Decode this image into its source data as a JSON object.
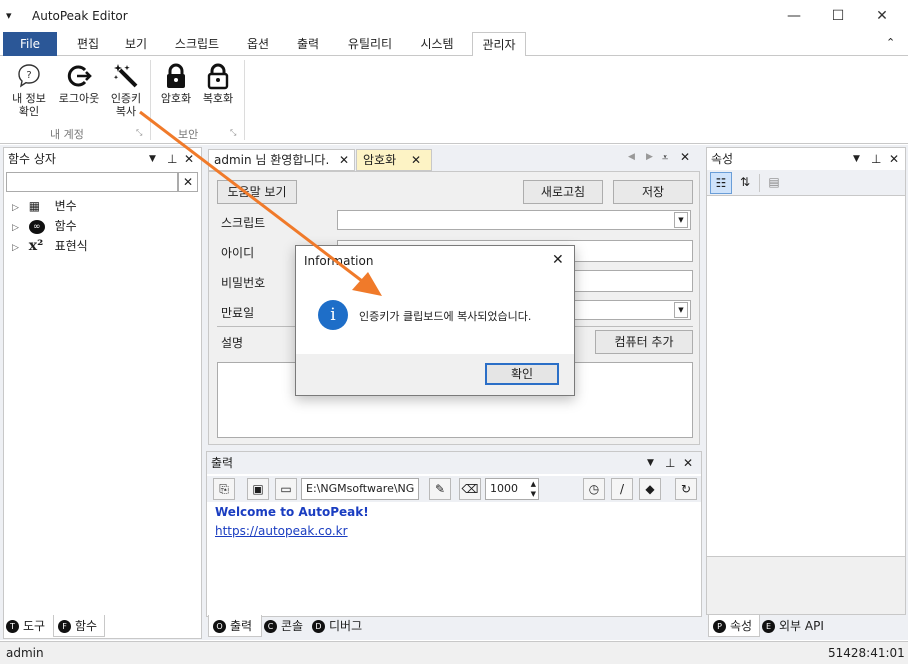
{
  "window": {
    "title": "AutoPeak Editor",
    "sys_menu_glyph": "▾",
    "min_glyph": "—",
    "max_glyph": "☐",
    "close_glyph": "✕"
  },
  "menu": {
    "file": "File",
    "tabs": [
      "편집",
      "보기",
      "스크립트",
      "옵션",
      "출력",
      "유틸리티",
      "시스템",
      "관리자"
    ],
    "collapse_glyph": "⌃"
  },
  "ribbon": {
    "account_buttons": [
      {
        "label1": "내 정보",
        "label2": "확인",
        "icon": "question-bubble-icon"
      },
      {
        "label1": "로그아웃",
        "label2": "",
        "icon": "logout-icon"
      },
      {
        "label1": "인증키",
        "label2": "복사",
        "icon": "magic-wand-icon"
      }
    ],
    "account_group": "내 계정",
    "security_buttons": [
      {
        "label1": "암호화",
        "icon": "lock-icon"
      },
      {
        "label1": "복호화",
        "icon": "unlock-icon"
      }
    ],
    "security_group": "보안"
  },
  "left_panel": {
    "title": "함수 상자",
    "tree": [
      {
        "label": "변수",
        "icon": "variable-icon"
      },
      {
        "label": "함수",
        "icon": "infinity-icon"
      },
      {
        "label": "표현식",
        "icon": "power-icon"
      }
    ],
    "tabs": [
      {
        "badge": "T",
        "label": "도구"
      },
      {
        "badge": "F",
        "label": "함수"
      }
    ]
  },
  "document": {
    "tabs": [
      {
        "label": "admin 님 환영합니다."
      },
      {
        "label": "암호화"
      }
    ],
    "help_button": "도움말 보기",
    "refresh_button": "새로고침",
    "save_button": "저장",
    "fields": {
      "script": "스크립트",
      "id": "아이디",
      "password": "비밀번호",
      "expiry": "만료일",
      "description": "설명"
    },
    "add_computer_button": "컴퓨터 추가"
  },
  "output_panel": {
    "title": "출력",
    "path_value": "E:\\NGMsoftware\\NG",
    "number_value": "1000",
    "welcome": "Welcome to AutoPeak!",
    "link": "https://autopeak.co.kr",
    "tabs": [
      {
        "badge": "O",
        "label": "출력"
      },
      {
        "badge": "C",
        "label": "콘솔"
      },
      {
        "badge": "D",
        "label": "디버그"
      }
    ]
  },
  "right_panel": {
    "title": "속성",
    "tabs": [
      {
        "badge": "P",
        "label": "속성"
      },
      {
        "badge": "E",
        "label": "외부 API"
      }
    ]
  },
  "dialog": {
    "title": "Information",
    "message": "인증키가 클립보드에 복사되었습니다.",
    "ok": "확인",
    "info_glyph": "i"
  },
  "status": {
    "user": "admin",
    "time": "51428:41:01"
  },
  "colors": {
    "accent": "#2b5797",
    "tab_highlight": "#fdf3c5",
    "arrow": "#f07a2a",
    "info_blue": "#1e6ec8"
  }
}
